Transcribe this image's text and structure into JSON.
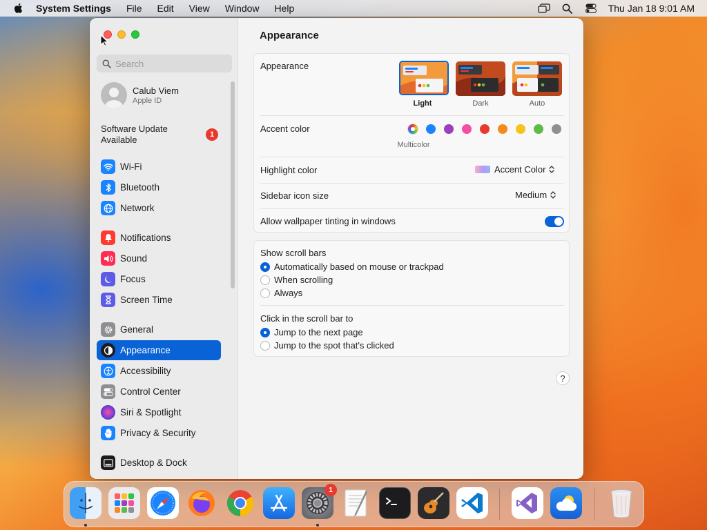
{
  "menubar": {
    "app_name": "System Settings",
    "menus": [
      "File",
      "Edit",
      "View",
      "Window",
      "Help"
    ],
    "clock": "Thu Jan 18  9:01 AM"
  },
  "window": {
    "search": {
      "placeholder": "Search",
      "value": ""
    },
    "account": {
      "name": "Calub Viem",
      "subtitle": "Apple ID"
    },
    "update": {
      "label": "Software Update Available",
      "badge": "1"
    },
    "sidebar": {
      "items": [
        {
          "label": "Wi-Fi",
          "icon": "wifi-icon",
          "color": "#1a84ff"
        },
        {
          "label": "Bluetooth",
          "icon": "bluetooth-icon",
          "color": "#1a84ff"
        },
        {
          "label": "Network",
          "icon": "globe-icon",
          "color": "#1a84ff"
        },
        {
          "label": "Notifications",
          "icon": "bell-icon",
          "color": "#ff3b30"
        },
        {
          "label": "Sound",
          "icon": "speaker-icon",
          "color": "#ff2d55"
        },
        {
          "label": "Focus",
          "icon": "moon-icon",
          "color": "#5e5ce6"
        },
        {
          "label": "Screen Time",
          "icon": "hourglass-icon",
          "color": "#5e5ce6"
        },
        {
          "label": "General",
          "icon": "gear-icon",
          "color": "#8e8e93"
        },
        {
          "label": "Appearance",
          "icon": "appearance-icon",
          "color": "#1c1c1e",
          "selected": true
        },
        {
          "label": "Accessibility",
          "icon": "accessibility-icon",
          "color": "#1a84ff"
        },
        {
          "label": "Control Center",
          "icon": "control-center-icon",
          "color": "#8e8e93"
        },
        {
          "label": "Siri & Spotlight",
          "icon": "siri-icon",
          "color": "#7a3ed6"
        },
        {
          "label": "Privacy & Security",
          "icon": "hand-icon",
          "color": "#1a84ff"
        },
        {
          "label": "Desktop & Dock",
          "icon": "dock-icon",
          "color": "#1c1c1e"
        }
      ]
    },
    "content": {
      "title": "Appearance",
      "appearance": {
        "label": "Appearance",
        "options": [
          {
            "label": "Light",
            "selected": true
          },
          {
            "label": "Dark",
            "selected": false
          },
          {
            "label": "Auto",
            "selected": false
          }
        ]
      },
      "accent": {
        "label": "Accent color",
        "selected_label": "Multicolor",
        "colors": [
          "multicolor",
          "#1a84ff",
          "#9d3fb8",
          "#f44fa4",
          "#e8392f",
          "#f58a1f",
          "#f6c31d",
          "#5fba46",
          "#8e8e93"
        ]
      },
      "highlight": {
        "label": "Highlight color",
        "value": "Accent Color"
      },
      "sidebar_icon_size": {
        "label": "Sidebar icon size",
        "value": "Medium"
      },
      "wallpaper_tinting": {
        "label": "Allow wallpaper tinting in windows",
        "enabled": true
      },
      "scroll_bars": {
        "label": "Show scroll bars",
        "options": [
          {
            "label": "Automatically based on mouse or trackpad",
            "selected": true
          },
          {
            "label": "When scrolling",
            "selected": false
          },
          {
            "label": "Always",
            "selected": false
          }
        ]
      },
      "click_scroll": {
        "label": "Click in the scroll bar to",
        "options": [
          {
            "label": "Jump to the next page",
            "selected": true
          },
          {
            "label": "Jump to the spot that's clicked",
            "selected": false
          }
        ]
      },
      "help": "?"
    }
  },
  "dock": {
    "apps": [
      "Finder",
      "Launchpad",
      "Safari",
      "Firefox",
      "Google Chrome",
      "App Store",
      "System Settings",
      "TextEdit",
      "Terminal",
      "GarageBand",
      "Visual Studio Code",
      "Visual Studio",
      "Weather",
      "Trash"
    ],
    "system_settings_badge": "1"
  }
}
